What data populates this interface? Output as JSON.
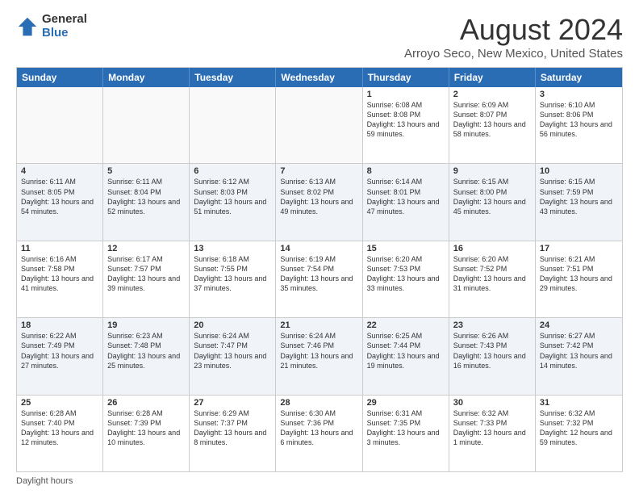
{
  "logo": {
    "general": "General",
    "blue": "Blue"
  },
  "title": "August 2024",
  "subtitle": "Arroyo Seco, New Mexico, United States",
  "days": [
    "Sunday",
    "Monday",
    "Tuesday",
    "Wednesday",
    "Thursday",
    "Friday",
    "Saturday"
  ],
  "weeks": [
    [
      {
        "day": "",
        "content": ""
      },
      {
        "day": "",
        "content": ""
      },
      {
        "day": "",
        "content": ""
      },
      {
        "day": "",
        "content": ""
      },
      {
        "day": "1",
        "content": "Sunrise: 6:08 AM\nSunset: 8:08 PM\nDaylight: 13 hours and 59 minutes."
      },
      {
        "day": "2",
        "content": "Sunrise: 6:09 AM\nSunset: 8:07 PM\nDaylight: 13 hours and 58 minutes."
      },
      {
        "day": "3",
        "content": "Sunrise: 6:10 AM\nSunset: 8:06 PM\nDaylight: 13 hours and 56 minutes."
      }
    ],
    [
      {
        "day": "4",
        "content": "Sunrise: 6:11 AM\nSunset: 8:05 PM\nDaylight: 13 hours and 54 minutes."
      },
      {
        "day": "5",
        "content": "Sunrise: 6:11 AM\nSunset: 8:04 PM\nDaylight: 13 hours and 52 minutes."
      },
      {
        "day": "6",
        "content": "Sunrise: 6:12 AM\nSunset: 8:03 PM\nDaylight: 13 hours and 51 minutes."
      },
      {
        "day": "7",
        "content": "Sunrise: 6:13 AM\nSunset: 8:02 PM\nDaylight: 13 hours and 49 minutes."
      },
      {
        "day": "8",
        "content": "Sunrise: 6:14 AM\nSunset: 8:01 PM\nDaylight: 13 hours and 47 minutes."
      },
      {
        "day": "9",
        "content": "Sunrise: 6:15 AM\nSunset: 8:00 PM\nDaylight: 13 hours and 45 minutes."
      },
      {
        "day": "10",
        "content": "Sunrise: 6:15 AM\nSunset: 7:59 PM\nDaylight: 13 hours and 43 minutes."
      }
    ],
    [
      {
        "day": "11",
        "content": "Sunrise: 6:16 AM\nSunset: 7:58 PM\nDaylight: 13 hours and 41 minutes."
      },
      {
        "day": "12",
        "content": "Sunrise: 6:17 AM\nSunset: 7:57 PM\nDaylight: 13 hours and 39 minutes."
      },
      {
        "day": "13",
        "content": "Sunrise: 6:18 AM\nSunset: 7:55 PM\nDaylight: 13 hours and 37 minutes."
      },
      {
        "day": "14",
        "content": "Sunrise: 6:19 AM\nSunset: 7:54 PM\nDaylight: 13 hours and 35 minutes."
      },
      {
        "day": "15",
        "content": "Sunrise: 6:20 AM\nSunset: 7:53 PM\nDaylight: 13 hours and 33 minutes."
      },
      {
        "day": "16",
        "content": "Sunrise: 6:20 AM\nSunset: 7:52 PM\nDaylight: 13 hours and 31 minutes."
      },
      {
        "day": "17",
        "content": "Sunrise: 6:21 AM\nSunset: 7:51 PM\nDaylight: 13 hours and 29 minutes."
      }
    ],
    [
      {
        "day": "18",
        "content": "Sunrise: 6:22 AM\nSunset: 7:49 PM\nDaylight: 13 hours and 27 minutes."
      },
      {
        "day": "19",
        "content": "Sunrise: 6:23 AM\nSunset: 7:48 PM\nDaylight: 13 hours and 25 minutes."
      },
      {
        "day": "20",
        "content": "Sunrise: 6:24 AM\nSunset: 7:47 PM\nDaylight: 13 hours and 23 minutes."
      },
      {
        "day": "21",
        "content": "Sunrise: 6:24 AM\nSunset: 7:46 PM\nDaylight: 13 hours and 21 minutes."
      },
      {
        "day": "22",
        "content": "Sunrise: 6:25 AM\nSunset: 7:44 PM\nDaylight: 13 hours and 19 minutes."
      },
      {
        "day": "23",
        "content": "Sunrise: 6:26 AM\nSunset: 7:43 PM\nDaylight: 13 hours and 16 minutes."
      },
      {
        "day": "24",
        "content": "Sunrise: 6:27 AM\nSunset: 7:42 PM\nDaylight: 13 hours and 14 minutes."
      }
    ],
    [
      {
        "day": "25",
        "content": "Sunrise: 6:28 AM\nSunset: 7:40 PM\nDaylight: 13 hours and 12 minutes."
      },
      {
        "day": "26",
        "content": "Sunrise: 6:28 AM\nSunset: 7:39 PM\nDaylight: 13 hours and 10 minutes."
      },
      {
        "day": "27",
        "content": "Sunrise: 6:29 AM\nSunset: 7:37 PM\nDaylight: 13 hours and 8 minutes."
      },
      {
        "day": "28",
        "content": "Sunrise: 6:30 AM\nSunset: 7:36 PM\nDaylight: 13 hours and 6 minutes."
      },
      {
        "day": "29",
        "content": "Sunrise: 6:31 AM\nSunset: 7:35 PM\nDaylight: 13 hours and 3 minutes."
      },
      {
        "day": "30",
        "content": "Sunrise: 6:32 AM\nSunset: 7:33 PM\nDaylight: 13 hours and 1 minute."
      },
      {
        "day": "31",
        "content": "Sunrise: 6:32 AM\nSunset: 7:32 PM\nDaylight: 12 hours and 59 minutes."
      }
    ]
  ],
  "footer": "Daylight hours"
}
